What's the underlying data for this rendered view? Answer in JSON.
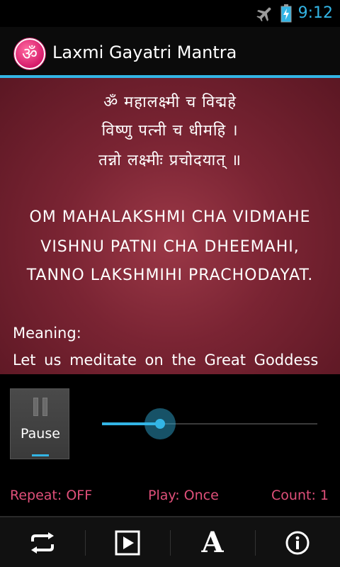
{
  "status_bar": {
    "time": "9:12",
    "icons": [
      "airplane-mode-icon",
      "battery-charging-icon"
    ],
    "accent_color": "#33b5e5"
  },
  "action_bar": {
    "title": "Laxmi Gayatri Mantra",
    "app_icon_glyph": "ॐ",
    "app_icon": "om-icon"
  },
  "mantra": {
    "sanskrit_lines": [
      "ॐ महालक्ष्मी च विद्महे",
      "विष्णु पत्नी च धीमहि ।",
      "तन्नो लक्ष्मीः प्रचोदयात् ॥"
    ],
    "latin_lines": [
      "OM MAHALAKSHMI CHA VIDMAHE",
      "VISHNU PATNI CHA DHEEMAHI,",
      "TANNO LAKSHMIHI PRACHODAYAT."
    ],
    "meaning_label": "Meaning:",
    "meaning_text": "Let us meditate on the Great Goddess"
  },
  "player": {
    "pause_label": "Pause",
    "progress": 0.27,
    "repeat": "Repeat: OFF",
    "play_mode": "Play: Once",
    "count": "Count: 1",
    "info_color": "#e0507a"
  },
  "bottom_bar": {
    "buttons": [
      "repeat-icon",
      "play-icon",
      "font-size-icon",
      "info-icon"
    ],
    "font_glyph": "A"
  }
}
